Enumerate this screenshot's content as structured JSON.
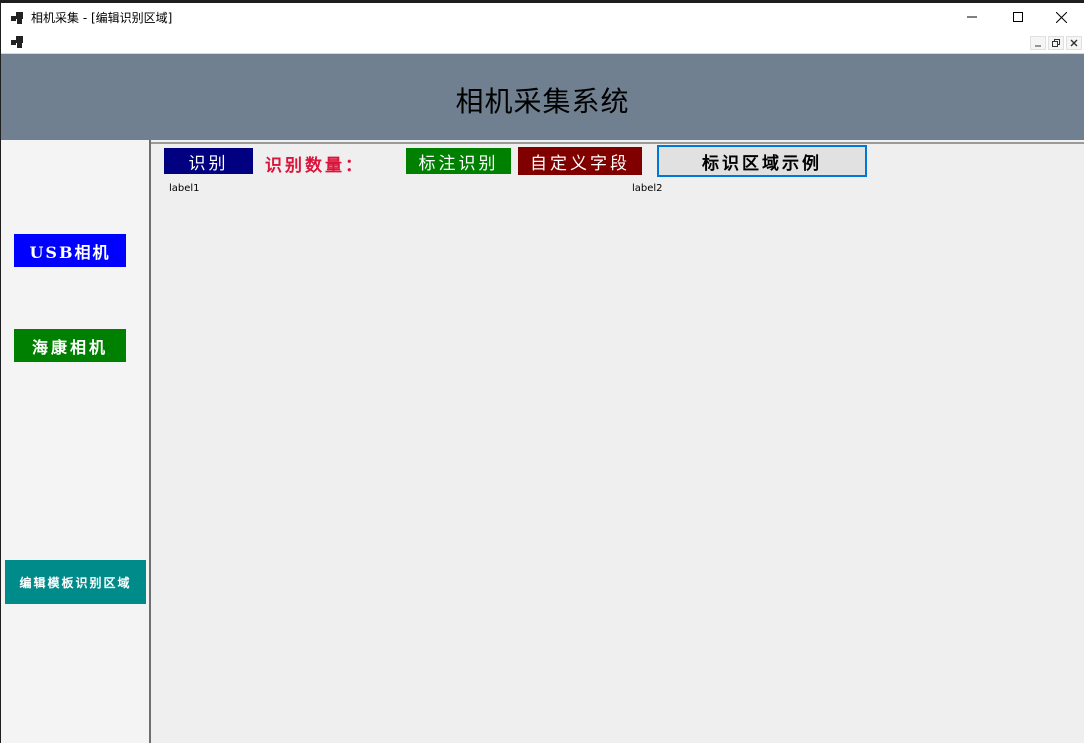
{
  "window": {
    "title": "相机采集 - [编辑识别区域]"
  },
  "header": {
    "title": "相机采集系统"
  },
  "sidebar": {
    "usb_camera": "USB相机",
    "hikvision_camera": "海康相机",
    "edit_template": "编辑模板识别区域"
  },
  "toolbar": {
    "recognize": "识别",
    "count_label": "识别数量：",
    "annotate": "标注识别",
    "custom_field": "自定义字段",
    "region_example": "标识区域示例"
  },
  "labels": {
    "label1": "label1",
    "label2": "label2"
  },
  "colors": {
    "header_bg": "#708090",
    "usb_btn": "#0000ff",
    "hik_btn": "#008000",
    "edit_btn": "#008b8b",
    "recognize_btn": "#000080",
    "annotate_btn": "#008000",
    "custom_btn": "#800000",
    "count_text": "#dc143c"
  }
}
